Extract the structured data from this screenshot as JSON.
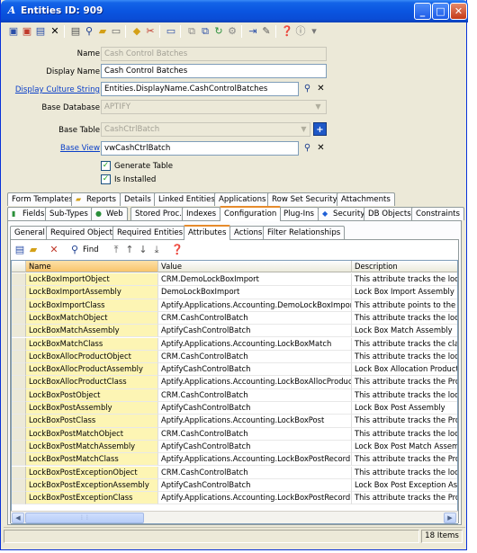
{
  "window": {
    "title": "Entities ID: 909",
    "app_glyph": "A"
  },
  "titlebar_buttons": [
    "_",
    "□",
    "✕"
  ],
  "toolbar_icons": [
    "save-icon",
    "save-new-icon",
    "save-close-icon",
    "delete-icon",
    "print-icon",
    "find-icon",
    "open-icon",
    "report-icon",
    "copy-icon",
    "cut-icon",
    "record-icon",
    "link-icon",
    "refresh-icon",
    "tools-icon",
    "lookup-icon",
    "attach-icon",
    "help-icon",
    "info-icon"
  ],
  "form": {
    "name_label": "Name",
    "name_value": "Cash Control Batches",
    "display_name_label": "Display Name",
    "display_name_value": "Cash Control Batches",
    "culture_label": "Display Culture String",
    "culture_value": "Entities.DisplayName.CashControlBatches",
    "base_db_label": "Base Database",
    "base_db_value": "APTIFY",
    "base_table_label": "Base Table",
    "base_table_value": "CashCtrlBatch",
    "base_view_label": "Base View",
    "base_view_value": "vwCashCtrlBatch",
    "generate_table_label": "Generate Table",
    "generate_table_checked": true,
    "is_installed_label": "Is Installed",
    "is_installed_checked": true
  },
  "tabs_row1": [
    "Form Templates",
    "Reports",
    "Details",
    "Linked Entities",
    "Applications",
    "Row Set Security",
    "Attachments"
  ],
  "tabs_row2": [
    "Fields",
    "Sub-Types",
    "Web",
    "Stored Proc.",
    "Indexes",
    "Configuration",
    "Plug-Ins",
    "Security",
    "DB Objects",
    "Constraints"
  ],
  "tabs_row2_active": "Configuration",
  "tabs_row3": [
    "General",
    "Required Objects",
    "Required Entities",
    "Attributes",
    "Actions",
    "Filter Relationships"
  ],
  "tabs_row3_active": "Attributes",
  "grid_toolbar": {
    "find_label": "Find"
  },
  "grid": {
    "columns": [
      "Name",
      "Value",
      "Description"
    ],
    "rows": [
      [
        "LockBoxImportObject",
        "CRM.DemoLockBoxImport",
        "This attribute tracks the location"
      ],
      [
        "LockBoxImportAssembly",
        "DemoLockBoxImport",
        "Lock Box Import Assembly"
      ],
      [
        "LockBoxImportClass",
        "Aptify.Applications.Accounting.DemoLockBoxImport",
        "This attribute points to the class"
      ],
      [
        "LockBoxMatchObject",
        "CRM.CashControlBatch",
        "This attribute tracks the location"
      ],
      [
        "LockBoxMatchAssembly",
        "AptifyCashControlBatch",
        "Lock Box Match Assembly"
      ],
      [
        "LockBoxMatchClass",
        "Aptify.Applications.Accounting.LockBoxMatch",
        "This attribute tracks the class na"
      ],
      [
        "LockBoxAllocProductObject",
        "CRM.CashControlBatch",
        "This attribute tracks the location"
      ],
      [
        "LockBoxAllocProductAssembly",
        "AptifyCashControlBatch",
        "Lock Box Allocation Product Asser"
      ],
      [
        "LockBoxAllocProductClass",
        "Aptify.Applications.Accounting.LockBoxAllocProducts",
        "This attribute tracks the ProgID c"
      ],
      [
        "LockBoxPostObject",
        "CRM.CashControlBatch",
        "This attribute tracks the location"
      ],
      [
        "LockBoxPostAssembly",
        "AptifyCashControlBatch",
        "Lock Box Post Assembly"
      ],
      [
        "LockBoxPostClass",
        "Aptify.Applications.Accounting.LockBoxPost",
        "This attribute tracks the ProgID c"
      ],
      [
        "LockBoxPostMatchObject",
        "CRM.CashControlBatch",
        "This attribute tracks the location"
      ],
      [
        "LockBoxPostMatchAssembly",
        "AptifyCashControlBatch",
        "Lock Box Post Match Assembly"
      ],
      [
        "LockBoxPostMatchClass",
        "Aptify.Applications.Accounting.LockBoxPostRecord",
        "This attribute tracks the ProgID"
      ],
      [
        "LockBoxPostExceptionObject",
        "CRM.CashControlBatch",
        "This attribute tracks the location"
      ],
      [
        "LockBoxPostExceptionAssembly",
        "AptifyCashControlBatch",
        "Lock Box Post Exception Assembly"
      ],
      [
        "LockBoxPostExceptionClass",
        "Aptify.Applications.Accounting.LockBoxPostRecord",
        "This attribute tracks the ProgID c"
      ]
    ]
  },
  "status": {
    "items_count": "18 Items"
  }
}
